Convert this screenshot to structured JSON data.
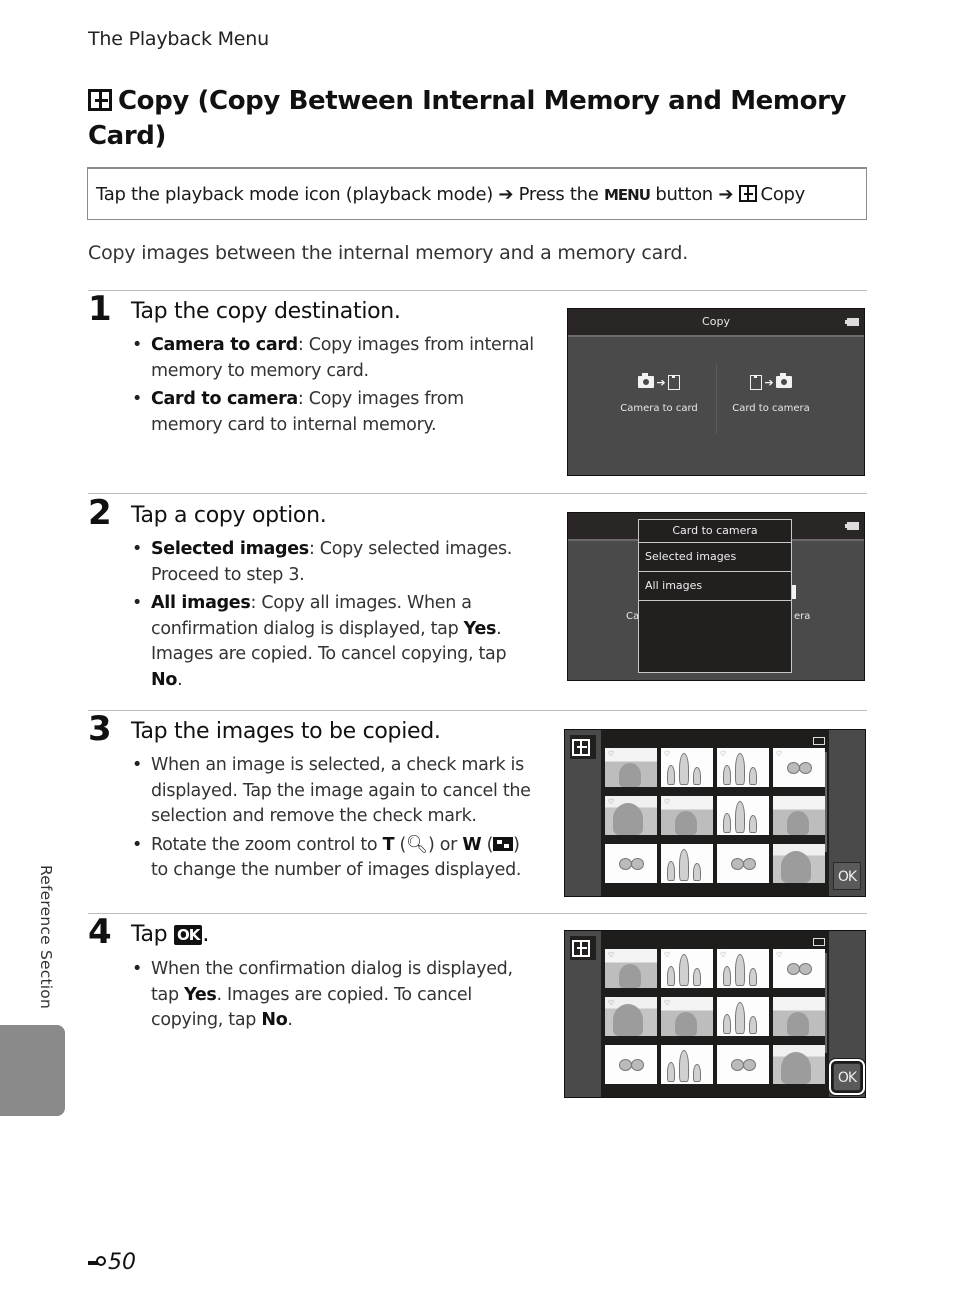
{
  "header": {
    "running_head": "The Playback Menu"
  },
  "title": {
    "icon": "copy-icon",
    "text": "Copy (Copy Between Internal Memory and Memory Card)"
  },
  "nav_path": {
    "part1": "Tap the playback mode icon (playback mode)",
    "arrow": "➔",
    "part2": "Press the",
    "menu_word": "MENU",
    "part3": "button",
    "part4": "Copy"
  },
  "intro": "Copy images between the internal memory and a memory card.",
  "steps": [
    {
      "number": "1",
      "title": "Tap the copy destination.",
      "bullets": [
        {
          "bold": "Camera to card",
          "text": ": Copy images from internal memory to memory card."
        },
        {
          "bold": "Card to camera",
          "text": ": Copy images from memory card to internal memory."
        }
      ]
    },
    {
      "number": "2",
      "title": "Tap a copy option.",
      "bullets": [
        {
          "bold": "Selected images",
          "text": ": Copy selected images. Proceed to step 3."
        },
        {
          "bold": "All images",
          "text1": ": Copy all images. When a confirmation dialog is displayed, tap ",
          "bold2": "Yes",
          "text2": ". Images are copied. To cancel copying, tap ",
          "bold3": "No",
          "text3": "."
        }
      ]
    },
    {
      "number": "3",
      "title": "Tap the images to be copied.",
      "bullets": [
        {
          "text": "When an image is selected, a check mark is displayed. Tap the image again to cancel the selection and remove the check mark."
        },
        {
          "text1": "Rotate the zoom control to ",
          "bold1": "T",
          "text2": " (",
          "icon1": "magnify-icon",
          "text3": ") or ",
          "bold2": "W",
          "text4": " (",
          "icon2": "thumbnail-grid-icon",
          "text5": ") to change the number of images displayed."
        }
      ]
    },
    {
      "number": "4",
      "title_prefix": "Tap",
      "title_ok": "OK",
      "title_suffix": ".",
      "bullets": [
        {
          "text1": "When the confirmation dialog is displayed, tap ",
          "bold1": "Yes",
          "text2": ". Images are copied. To cancel copying, tap ",
          "bold2": "No",
          "text3": "."
        }
      ]
    }
  ],
  "screens": {
    "copy_menu": {
      "title": "Copy",
      "options": [
        {
          "label": "Camera to card",
          "icon": "camera-to-card-icon"
        },
        {
          "label": "Card to camera",
          "icon": "card-to-camera-icon"
        }
      ]
    },
    "copy_option_popup": {
      "title": "Card to camera",
      "items": [
        "Selected images",
        "All images"
      ],
      "bg_left_fragment": "Ca",
      "bg_right_fragment": "era"
    },
    "image_grid": {
      "ok_label": "OK",
      "thumbnails": [
        "lake",
        "family",
        "family",
        "flower",
        "portrait",
        "lake",
        "family",
        "lake",
        "flower",
        "family",
        "flower",
        "portrait"
      ]
    }
  },
  "side": {
    "section_label": "Reference Section"
  },
  "footer": {
    "page_number": "50",
    "section_icon": "reference-section-icon"
  }
}
